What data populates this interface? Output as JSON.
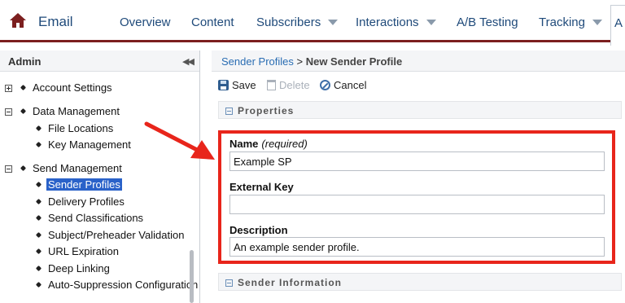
{
  "header": {
    "app_title": "Email",
    "tabs": [
      {
        "label": "Overview"
      },
      {
        "label": "Content"
      },
      {
        "label": "Subscribers"
      },
      {
        "label": "Interactions"
      },
      {
        "label": "A/B Testing"
      },
      {
        "label": "Tracking"
      },
      {
        "label": "A"
      }
    ]
  },
  "sidebar": {
    "title": "Admin",
    "collapse_glyph": "◀◀",
    "items": [
      {
        "label": "Account Settings"
      },
      {
        "label": "Data Management"
      },
      {
        "label": "File Locations"
      },
      {
        "label": "Key Management"
      },
      {
        "label": "Send Management"
      },
      {
        "label": "Sender Profiles",
        "selected": true
      },
      {
        "label": "Delivery Profiles"
      },
      {
        "label": "Send Classifications"
      },
      {
        "label": "Subject/Preheader Validation"
      },
      {
        "label": "URL Expiration"
      },
      {
        "label": "Deep Linking"
      },
      {
        "label": "Auto-Suppression Configuration"
      }
    ]
  },
  "main": {
    "breadcrumb": {
      "parent": "Sender Profiles",
      "separator": " > ",
      "current": "New Sender Profile"
    },
    "toolbar": {
      "save": "Save",
      "delete": "Delete",
      "cancel": "Cancel"
    },
    "sections": {
      "properties": "Properties",
      "sender_information": "Sender Information"
    },
    "fields": {
      "name_label": "Name",
      "name_required": "(required)",
      "name_value": "Example SP",
      "external_key_label": "External Key",
      "external_key_value": "",
      "description_label": "Description",
      "description_value": "An example sender profile."
    }
  },
  "colors": {
    "brand": "#7c1f1f",
    "link": "#2a6db3",
    "selection": "#2a62c9",
    "annotation": "#e8251b"
  },
  "icons": [
    "home-icon",
    "chevron-down-icon",
    "collapse-icon",
    "save-icon",
    "trash-icon",
    "cancel-icon",
    "arrow-icon"
  ]
}
